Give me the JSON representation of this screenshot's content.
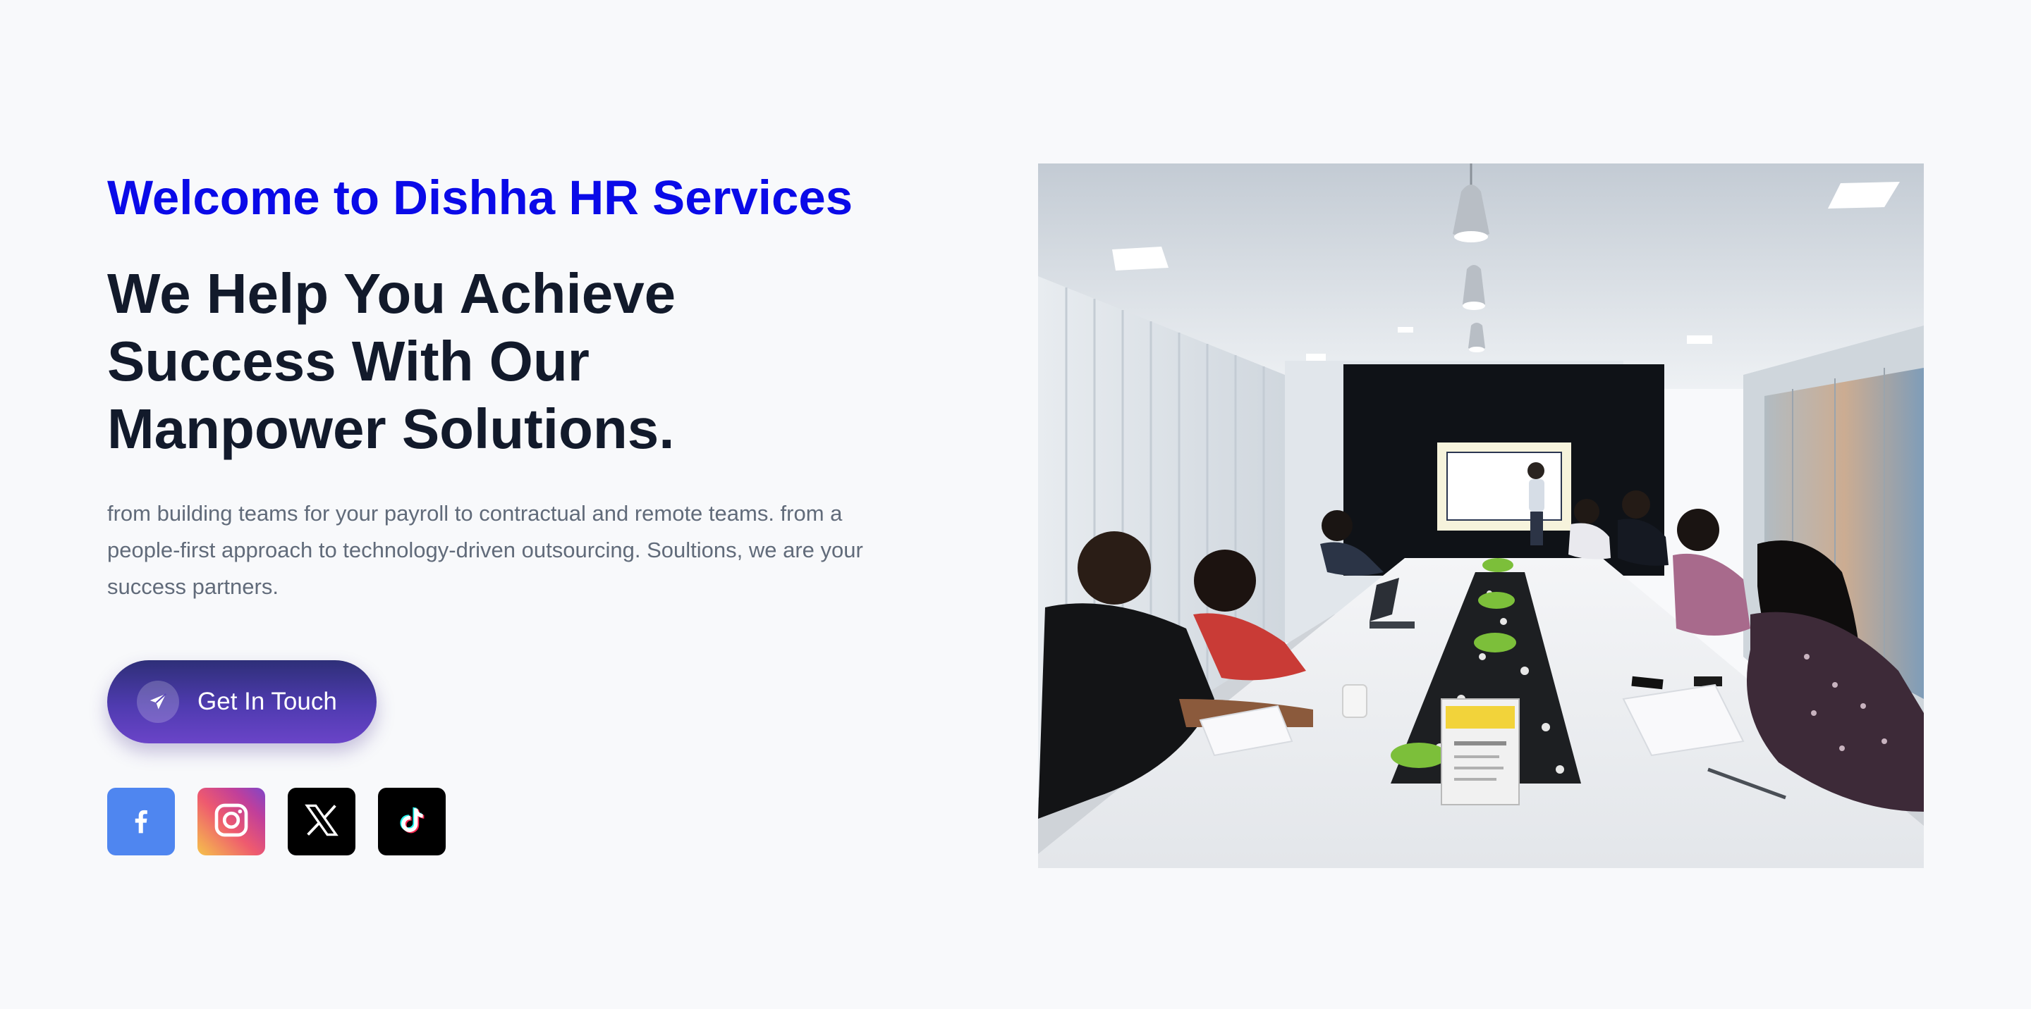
{
  "hero": {
    "welcome": "Welcome to Dishha HR Services",
    "headline": "We Help You Achieve Success With Our Manpower Solutions.",
    "description": "from building teams for your payroll to contractual and remote teams. from a people-first approach to technology-driven outsourcing. Soultions, we are your success partners.",
    "cta_label": "Get In Touch",
    "cta_icon": "paper-plane-icon"
  },
  "socials": [
    {
      "name": "facebook",
      "icon": "facebook-icon",
      "color": "#4f86f0"
    },
    {
      "name": "instagram",
      "icon": "instagram-icon",
      "color": "#c13f9a"
    },
    {
      "name": "x",
      "icon": "x-icon",
      "color": "#000000"
    },
    {
      "name": "tiktok",
      "icon": "tiktok-icon",
      "color": "#000000"
    }
  ],
  "colors": {
    "welcome": "#0a0ae8",
    "headline": "#121a2b",
    "description": "#616b7a",
    "background": "#f8f9fb",
    "cta_gradient_start": "#2e2f78",
    "cta_gradient_end": "#6a44c8"
  },
  "image": {
    "subject": "meeting-room-photo"
  }
}
